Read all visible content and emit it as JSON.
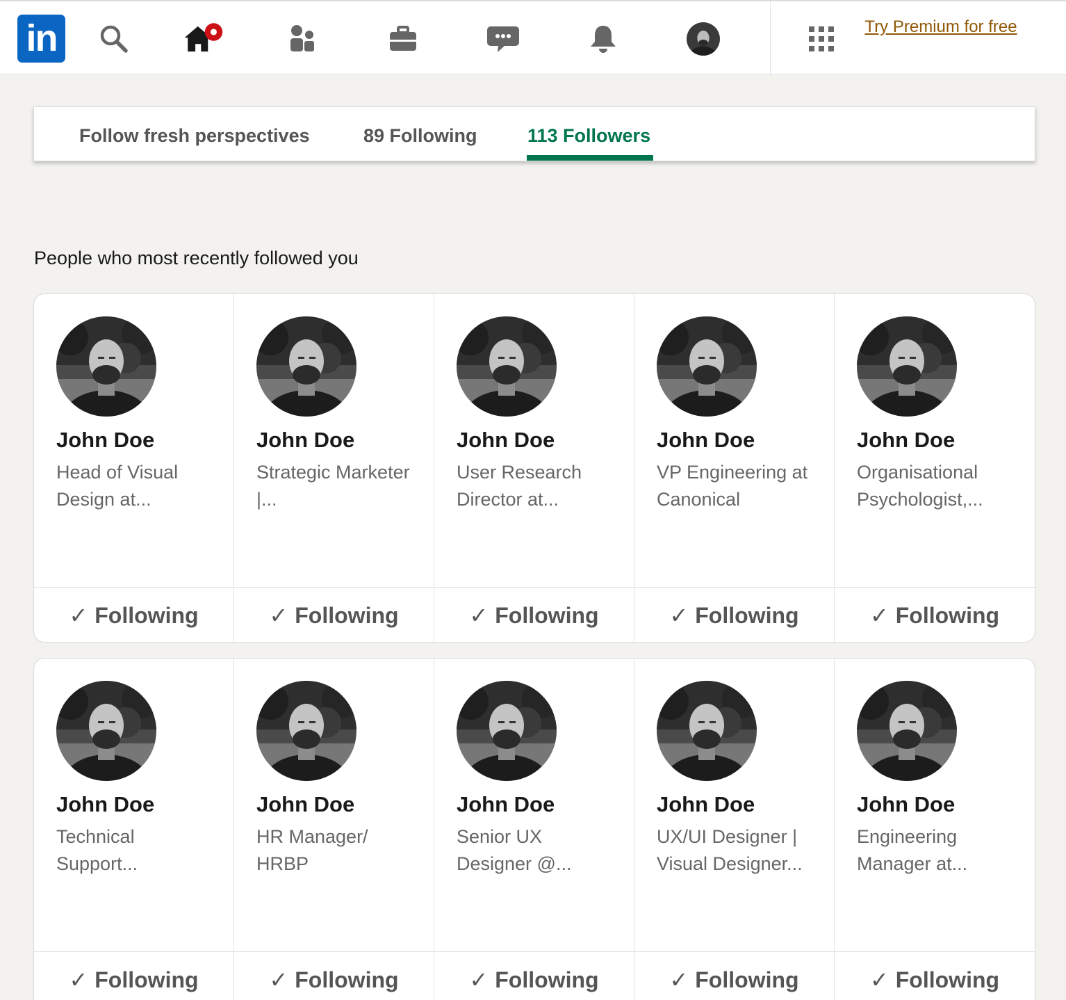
{
  "nav": {
    "logo_text": "in",
    "premium_label": "Try Premium for free",
    "icons": [
      "search-icon",
      "home-icon",
      "my-network-icon",
      "jobs-icon",
      "messaging-icon",
      "notifications-icon",
      "me-avatar",
      "work-grid-icon"
    ],
    "brand_color": "#0a66c2",
    "notification_dot_color": "#cc1016"
  },
  "tabs": [
    {
      "label": "Follow fresh perspectives",
      "active": false
    },
    {
      "label": "89 Following",
      "active": false
    },
    {
      "label": "113 Followers",
      "active": true
    }
  ],
  "active_tab_color": "#01754f",
  "section_title": "People who most recently followed you",
  "followers": [
    {
      "name": "John Doe",
      "headline": "Head of Visual Design at...",
      "button": "Following"
    },
    {
      "name": "John Doe",
      "headline": "Strategic Marketer |...",
      "button": "Following"
    },
    {
      "name": "John Doe",
      "headline": "User Research Director at...",
      "button": "Following"
    },
    {
      "name": "John Doe",
      "headline": "VP Engineering at Canonical",
      "button": "Following"
    },
    {
      "name": "John Doe",
      "headline": "Organisational Psychologist,...",
      "button": "Following"
    },
    {
      "name": "John Doe",
      "headline": "Technical Support...",
      "button": "Following"
    },
    {
      "name": "John Doe",
      "headline": "HR Manager/ HRBP",
      "button": "Following"
    },
    {
      "name": "John Doe",
      "headline": "Senior UX Designer @...",
      "button": "Following"
    },
    {
      "name": "John Doe",
      "headline": "UX/UI Designer | Visual Designer...",
      "button": "Following"
    },
    {
      "name": "John Doe",
      "headline": "Engineering Manager at...",
      "button": "Following"
    }
  ],
  "check_glyph": "✓"
}
